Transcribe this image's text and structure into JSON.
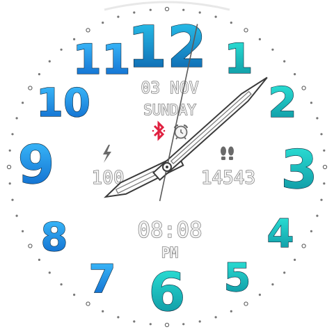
{
  "watch": {
    "numerals": [
      "12",
      "1",
      "2",
      "3",
      "4",
      "5",
      "6",
      "7",
      "8",
      "9",
      "10",
      "11"
    ],
    "date": "03 NOV",
    "weekday": "SUNDAY",
    "battery_value": "100",
    "steps_value": "14543",
    "digital_time": "08:08",
    "ampm": "PM",
    "hands": {
      "hour": 8,
      "minute": 8,
      "second": 2
    },
    "icons": {
      "bluetooth": "bluetooth-icon",
      "alarm": "alarm-clock-icon",
      "battery": "lightning-bolt-icon",
      "steps": "footprints-icon"
    },
    "colors": {
      "background": "#ffffff",
      "numeral_top": "#1da8f0",
      "numeral_right": "#1fd6c4",
      "numeral_dark": "#0f6fc0",
      "bluetooth": "#e02040",
      "info_text_stroke": "#6f6f6f",
      "hand_fill": "#ffffff",
      "hand_stroke": "#3a3a3a"
    }
  }
}
